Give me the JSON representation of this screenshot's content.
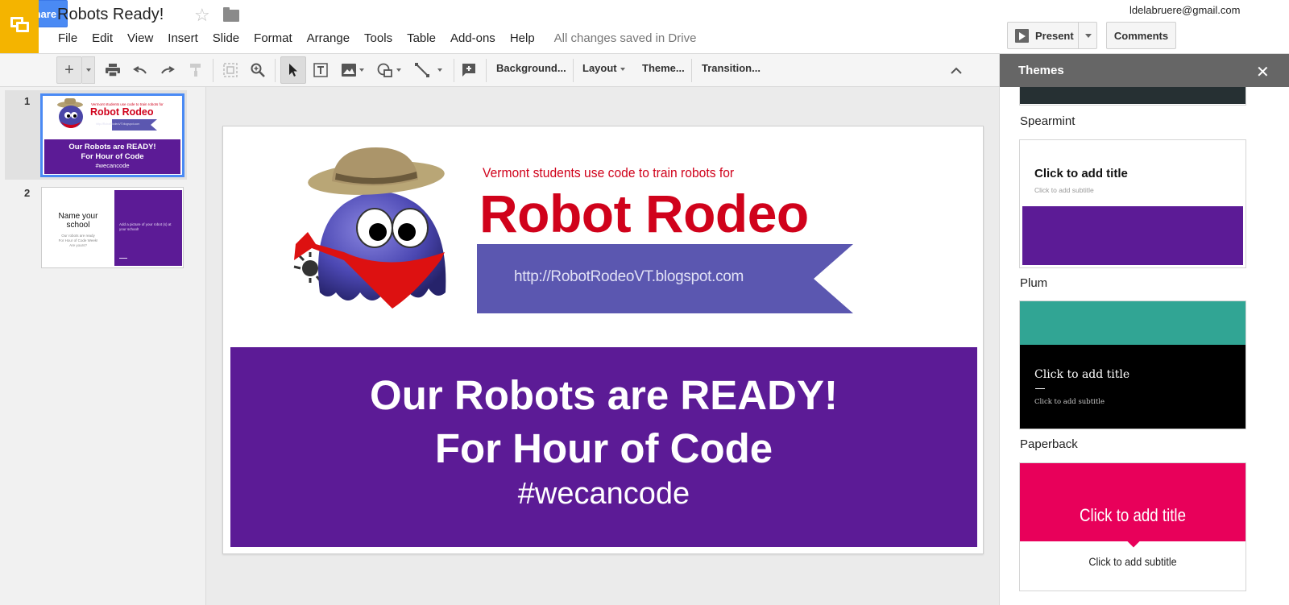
{
  "app": {
    "title": "Robots Ready!",
    "user_email": "ldelabruere@gmail.com"
  },
  "menu": [
    "File",
    "Edit",
    "View",
    "Insert",
    "Slide",
    "Format",
    "Arrange",
    "Tools",
    "Table",
    "Add-ons",
    "Help"
  ],
  "save_status": "All changes saved in Drive",
  "header_buttons": {
    "present": "Present",
    "comments": "Comments",
    "share": "Share"
  },
  "toolbar": {
    "background": "Background...",
    "layout": "Layout",
    "theme": "Theme...",
    "transition": "Transition..."
  },
  "filmstrip": {
    "slides": [
      {
        "number": "1",
        "tagline": "Vermont students use code to train robots for",
        "title": "Robot Rodeo",
        "url": "http://RobotRodeoVT.blogspot.com",
        "box_title_1": "Our Robots are READY!",
        "box_title_2": "For Hour of Code",
        "box_hashtag": "#wecancode"
      },
      {
        "number": "2",
        "title_line1": "Name your",
        "title_line2": "school",
        "body_line1": "Our robots are ready",
        "body_line2": "For Hour of Code Week!",
        "body_line3": "Are yours?",
        "side_text": "Add a picture of your robot (s) at your school!"
      }
    ]
  },
  "slide": {
    "tagline": "Vermont students use code to  train robots for",
    "logo_title": "Robot Rodeo",
    "url": "http://RobotRodeoVT.blogspot.com",
    "title_line1": "Our Robots are READY!",
    "title_line2": "For Hour of Code",
    "hashtag": "#wecancode"
  },
  "themes_panel": {
    "title": "Themes",
    "themes": [
      {
        "name": "Spearmint"
      },
      {
        "name": "Plum",
        "title_placeholder": "Click to add title",
        "subtitle_placeholder": "Click to add subtitle"
      },
      {
        "name": "Paperback",
        "title_placeholder": "Click to add title",
        "subtitle_placeholder": "Click to add subtitle"
      },
      {
        "name": "",
        "title_placeholder": "Click to add title",
        "subtitle_placeholder": "Click to add subtitle"
      }
    ]
  },
  "colors": {
    "app_yellow": "#f4b400",
    "share_blue": "#4a8af4",
    "slide_purple": "#5c1b96",
    "logo_red": "#d0021b",
    "ribbon_blue": "#5b57b0",
    "paperback_teal": "#31a594",
    "pink": "#e8005a"
  }
}
